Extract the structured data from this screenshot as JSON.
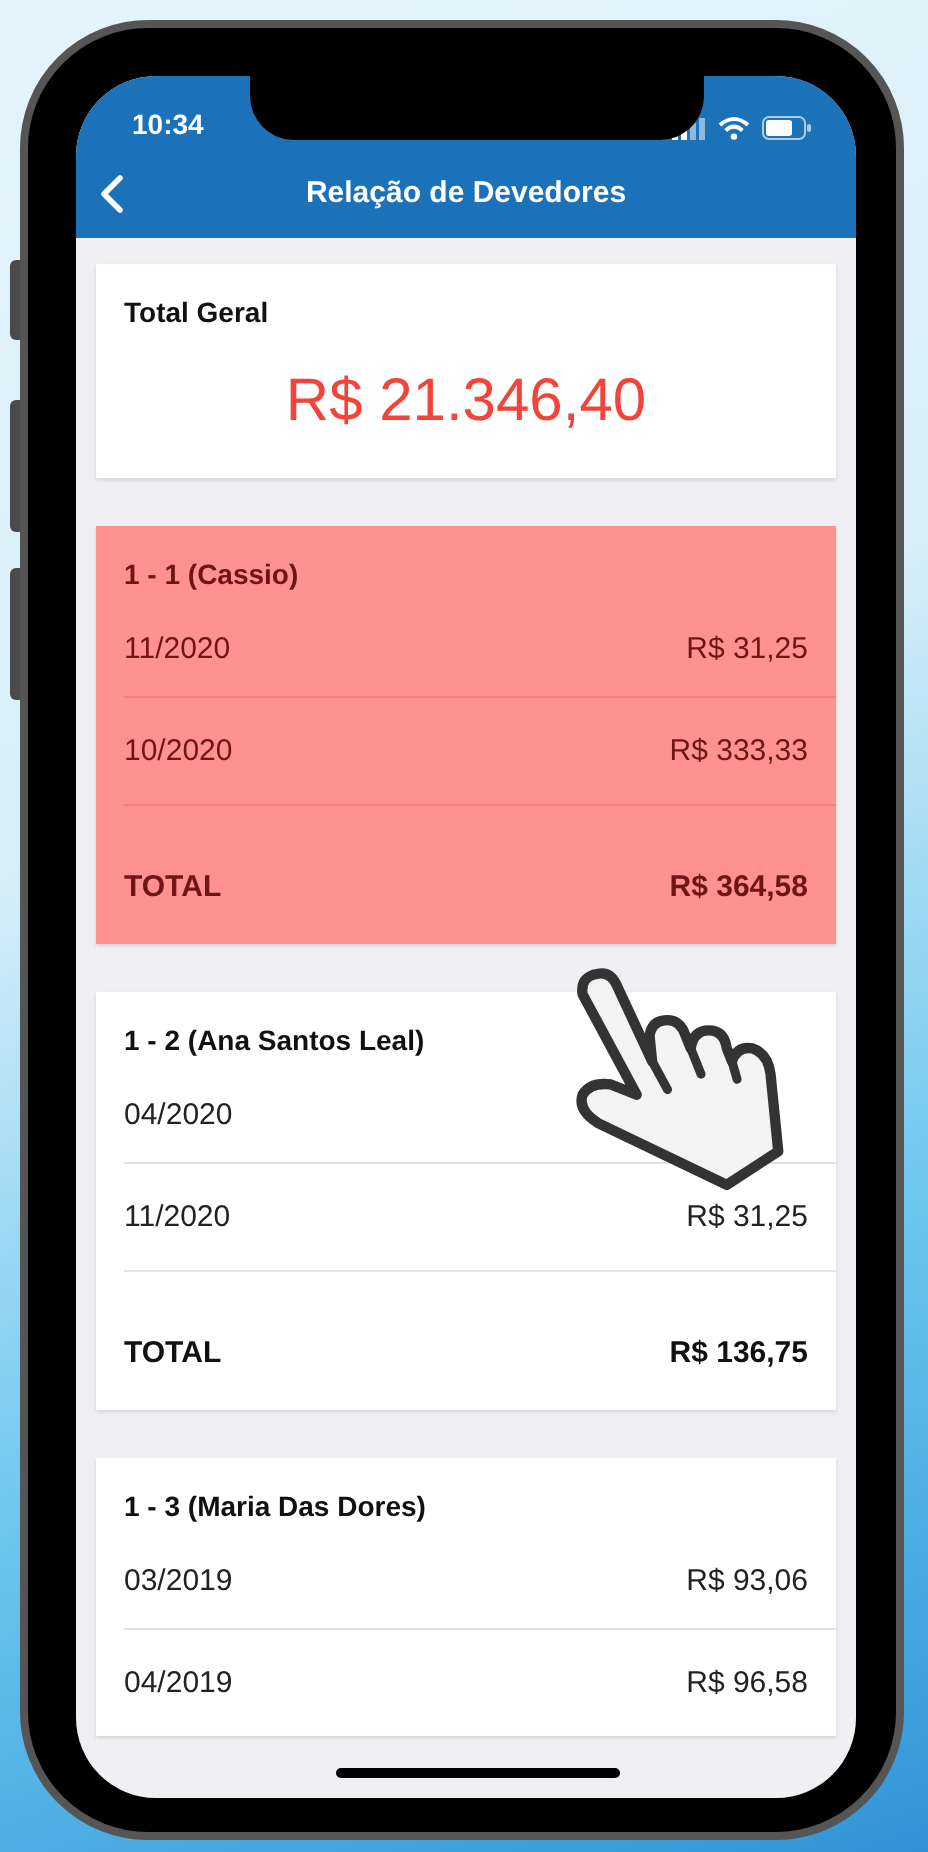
{
  "status_bar": {
    "time": "10:34"
  },
  "header": {
    "title": "Relação de Devedores"
  },
  "total_card": {
    "label": "Total Geral",
    "amount": "R$ 21.346,40"
  },
  "debtors": [
    {
      "name": "1 - 1 (Cassio)",
      "selected": true,
      "entries": [
        {
          "period": "11/2020",
          "amount": "R$ 31,25"
        },
        {
          "period": "10/2020",
          "amount": "R$ 333,33"
        }
      ],
      "total_label": "TOTAL",
      "total": "R$ 364,58"
    },
    {
      "name": "1 - 2 (Ana Santos Leal)",
      "selected": false,
      "entries": [
        {
          "period": "04/2020"
        },
        {
          "period": "11/2020",
          "amount": "R$ 31,25"
        }
      ],
      "total_label": "TOTAL",
      "total": "R$ 136,75"
    },
    {
      "name": "1 - 3 (Maria Das Dores)",
      "selected": false,
      "entries": [
        {
          "period": "03/2019",
          "amount": "R$ 93,06"
        },
        {
          "period": "04/2019",
          "amount": "R$ 96,58"
        }
      ]
    }
  ]
}
